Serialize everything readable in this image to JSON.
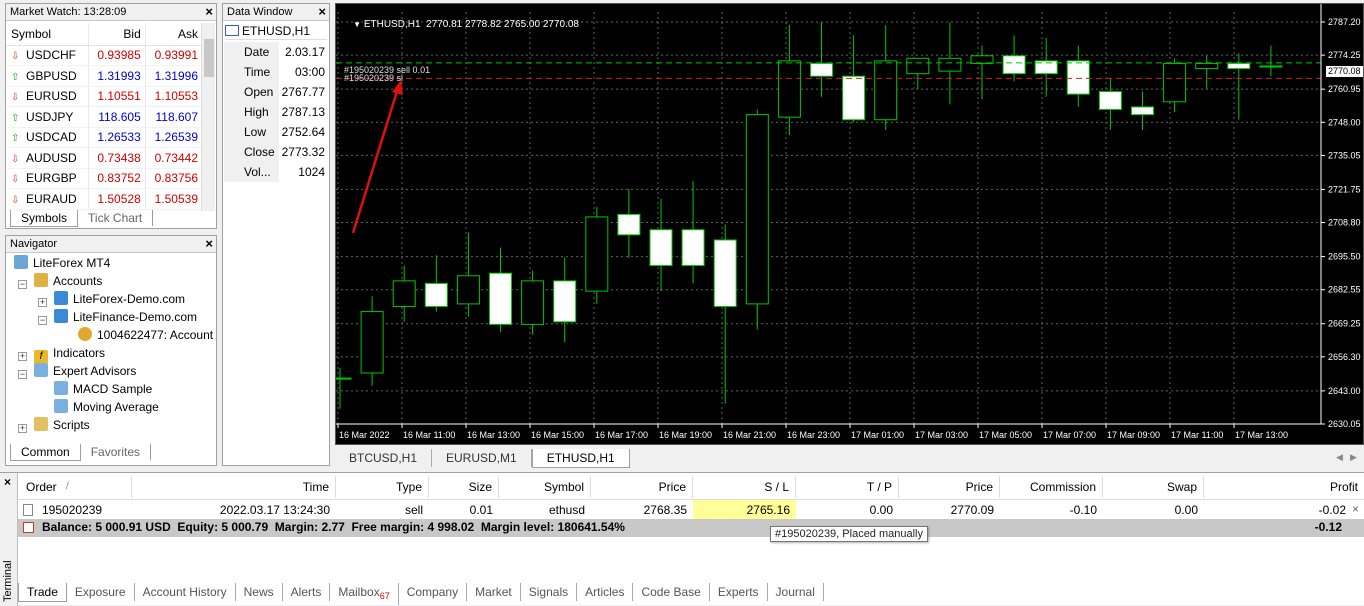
{
  "market_watch": {
    "title": "Market Watch: 13:28:09",
    "columns": [
      "Symbol",
      "Bid",
      "Ask"
    ],
    "rows": [
      {
        "symbol": "USDCHF",
        "bid": "0.93985",
        "ask": "0.93991",
        "dir": "down"
      },
      {
        "symbol": "GBPUSD",
        "bid": "1.31993",
        "ask": "1.31996",
        "dir": "up"
      },
      {
        "symbol": "EURUSD",
        "bid": "1.10551",
        "ask": "1.10553",
        "dir": "down"
      },
      {
        "symbol": "USDJPY",
        "bid": "118.605",
        "ask": "118.607",
        "dir": "up"
      },
      {
        "symbol": "USDCAD",
        "bid": "1.26533",
        "ask": "1.26539",
        "dir": "up"
      },
      {
        "symbol": "AUDUSD",
        "bid": "0.73438",
        "ask": "0.73442",
        "dir": "down"
      },
      {
        "symbol": "EURGBP",
        "bid": "0.83752",
        "ask": "0.83756",
        "dir": "down"
      },
      {
        "symbol": "EURAUD",
        "bid": "1.50528",
        "ask": "1.50539",
        "dir": "down"
      }
    ],
    "tabs": [
      "Symbols",
      "Tick Chart"
    ]
  },
  "data_window": {
    "title": "Data Window",
    "symbol": "ETHUSD,H1",
    "rows": [
      {
        "k": "Date",
        "v": "2.03.17"
      },
      {
        "k": "Time",
        "v": "03:00"
      },
      {
        "k": "Open",
        "v": "2767.77"
      },
      {
        "k": "High",
        "v": "2787.13"
      },
      {
        "k": "Low",
        "v": "2752.64"
      },
      {
        "k": "Close",
        "v": "2773.32"
      },
      {
        "k": "Vol...",
        "v": "1024"
      }
    ]
  },
  "navigator": {
    "title": "Navigator",
    "items": [
      "LiteForex MT4",
      "Accounts",
      "LiteForex-Demo.com",
      "LiteFinance-Demo.com",
      "1004622477: Account",
      "Indicators",
      "Expert Advisors",
      "MACD Sample",
      "Moving Average",
      "Scripts"
    ],
    "tabs": [
      "Common",
      "Favorites"
    ]
  },
  "chart": {
    "header": "ETHUSD,H1  2770.81 2778.82 2765.00 2770.08",
    "order_label_1": "#195020239 sell 0.01",
    "order_label_2": "#195020239 sl",
    "current_price": "2770.08",
    "price_axis": [
      "2787.20",
      "2774.25",
      "2760.95",
      "2748.00",
      "2735.05",
      "2721.75",
      "2708.80",
      "2695.50",
      "2682.55",
      "2669.25",
      "2656.30",
      "2643.00",
      "2630.05"
    ],
    "time_axis": [
      "16 Mar 2022",
      "16 Mar 11:00",
      "16 Mar 13:00",
      "16 Mar 15:00",
      "16 Mar 17:00",
      "16 Mar 19:00",
      "16 Mar 21:00",
      "16 Mar 23:00",
      "17 Mar 01:00",
      "17 Mar 03:00",
      "17 Mar 05:00",
      "17 Mar 07:00",
      "17 Mar 09:00",
      "17 Mar 11:00",
      "17 Mar 13:00"
    ],
    "tabs": [
      "BTCUSD,H1",
      "EURUSD,M1",
      "ETHUSD,H1"
    ],
    "colors": {
      "bg": "#000000",
      "up": "#00c800",
      "grid": "#5a6a5a",
      "axis": "#ffffff",
      "sell_line": "#00c800",
      "sl_line": "#d02020",
      "annotation_arrow": "#e01010"
    }
  },
  "chart_data": {
    "type": "candlestick",
    "ylim": [
      2630.05,
      2787.2
    ],
    "candles": [
      {
        "o": 2648.0,
        "h": 2652.0,
        "l": 2636.0,
        "c": 2648.0
      },
      {
        "o": 2650.0,
        "h": 2680.0,
        "l": 2645.0,
        "c": 2674.0
      },
      {
        "o": 2676.0,
        "h": 2692.0,
        "l": 2670.0,
        "c": 2686.0
      },
      {
        "o": 2685.0,
        "h": 2696.0,
        "l": 2674.0,
        "c": 2676.0
      },
      {
        "o": 2677.0,
        "h": 2705.0,
        "l": 2672.0,
        "c": 2688.0
      },
      {
        "o": 2689.0,
        "h": 2699.0,
        "l": 2666.0,
        "c": 2669.0
      },
      {
        "o": 2669.0,
        "h": 2690.0,
        "l": 2665.0,
        "c": 2686.0
      },
      {
        "o": 2686.0,
        "h": 2695.0,
        "l": 2662.0,
        "c": 2670.0
      },
      {
        "o": 2682.0,
        "h": 2715.0,
        "l": 2677.0,
        "c": 2711.0
      },
      {
        "o": 2712.0,
        "h": 2722.0,
        "l": 2695.0,
        "c": 2704.0
      },
      {
        "o": 2706.0,
        "h": 2718.0,
        "l": 2682.0,
        "c": 2692.0
      },
      {
        "o": 2706.0,
        "h": 2725.0,
        "l": 2685.0,
        "c": 2692.0
      },
      {
        "o": 2702.0,
        "h": 2708.0,
        "l": 2638.0,
        "c": 2676.0
      },
      {
        "o": 2677.0,
        "h": 2753.0,
        "l": 2667.0,
        "c": 2751.0
      },
      {
        "o": 2750.0,
        "h": 2786.0,
        "l": 2743.0,
        "c": 2772.0
      },
      {
        "o": 2771.0,
        "h": 2787.0,
        "l": 2758.0,
        "c": 2766.0
      },
      {
        "o": 2766.0,
        "h": 2782.0,
        "l": 2748.0,
        "c": 2749.0
      },
      {
        "o": 2749.0,
        "h": 2786.0,
        "l": 2745.0,
        "c": 2772.0
      },
      {
        "o": 2767.0,
        "h": 2773.0,
        "l": 2761.0,
        "c": 2773.0
      },
      {
        "o": 2768.0,
        "h": 2787.0,
        "l": 2755.0,
        "c": 2773.0
      },
      {
        "o": 2771.0,
        "h": 2778.0,
        "l": 2757.0,
        "c": 2774.0
      },
      {
        "o": 2774.0,
        "h": 2782.0,
        "l": 2764.0,
        "c": 2767.0
      },
      {
        "o": 2772.0,
        "h": 2781.0,
        "l": 2758.0,
        "c": 2767.0
      },
      {
        "o": 2772.0,
        "h": 2778.0,
        "l": 2754.0,
        "c": 2759.0
      },
      {
        "o": 2760.0,
        "h": 2765.0,
        "l": 2745.0,
        "c": 2753.0
      },
      {
        "o": 2754.0,
        "h": 2760.0,
        "l": 2745.0,
        "c": 2751.0
      },
      {
        "o": 2756.0,
        "h": 2773.0,
        "l": 2752.0,
        "c": 2771.0
      },
      {
        "o": 2769.0,
        "h": 2774.0,
        "l": 2761.0,
        "c": 2771.0
      },
      {
        "o": 2771.0,
        "h": 2775.0,
        "l": 2749.0,
        "c": 2769.0
      },
      {
        "o": 2770.0,
        "h": 2778.0,
        "l": 2766.0,
        "c": 2770.0
      }
    ],
    "sell_price": 2771.2,
    "sl_price": 2765.16
  },
  "terminal": {
    "side_label": "Terminal",
    "columns": [
      "Order",
      "/",
      "Time",
      "Type",
      "Size",
      "Symbol",
      "Price",
      "S / L",
      "T / P",
      "Price",
      "Commission",
      "Swap",
      "Profit"
    ],
    "order": {
      "order": "195020239",
      "time": "2022.03.17 13:24:30",
      "type": "sell",
      "size": "0.01",
      "symbol": "ethusd",
      "price": "2768.35",
      "sl": "2765.16",
      "tp": "0.00",
      "cur_price": "2770.09",
      "commission": "-0.10",
      "swap": "0.00",
      "profit": "-0.02"
    },
    "balance_line": "Balance: 5 000.91 USD  Equity: 5 000.79  Margin: 2.77  Free margin: 4 998.02  Margin level: 180641.54%",
    "total_profit": "-0.12",
    "tooltip": "#195020239, Placed manually",
    "tabs": [
      "Trade",
      "Exposure",
      "Account History",
      "News",
      "Alerts",
      "Mailbox",
      "Company",
      "Market",
      "Signals",
      "Articles",
      "Code Base",
      "Experts",
      "Journal"
    ],
    "mailbox_badge": "67"
  }
}
